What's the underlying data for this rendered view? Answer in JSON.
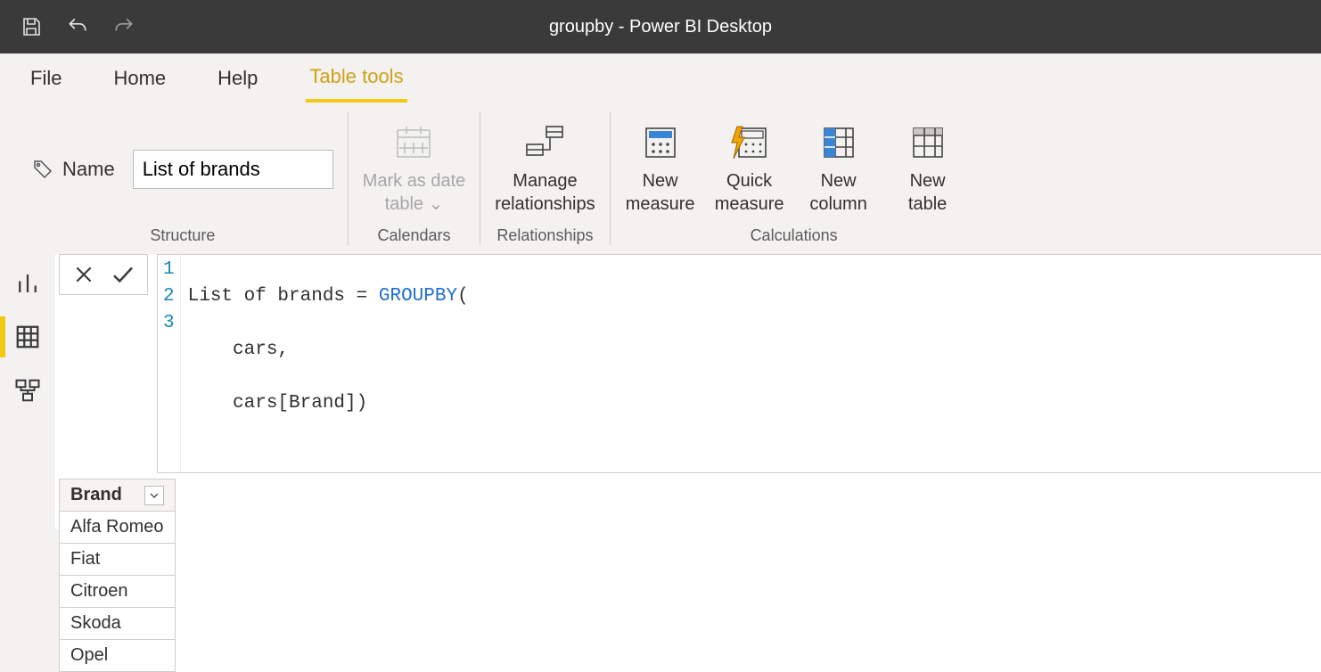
{
  "titlebar": {
    "title": "groupby - Power BI Desktop"
  },
  "ribbon_tabs": {
    "file": "File",
    "home": "Home",
    "help": "Help",
    "table_tools": "Table tools"
  },
  "structure": {
    "group_label": "Structure",
    "name_label": "Name",
    "name_value": "List of brands"
  },
  "calendars": {
    "group_label": "Calendars",
    "mark_date_line1": "Mark as date",
    "mark_date_line2": "table"
  },
  "relationships": {
    "group_label": "Relationships",
    "manage_line1": "Manage",
    "manage_line2": "relationships"
  },
  "calculations": {
    "group_label": "Calculations",
    "new_measure_line1": "New",
    "new_measure_line2": "measure",
    "quick_measure_line1": "Quick",
    "quick_measure_line2": "measure",
    "new_column_line1": "New",
    "new_column_line2": "column",
    "new_table_line1": "New",
    "new_table_line2": "table"
  },
  "formula": {
    "gutter": [
      "1",
      "2",
      "3"
    ],
    "line1_pre": "List of brands = ",
    "line1_func": "GROUPBY",
    "line1_post": "(",
    "line2": "    cars,",
    "line3": "    cars[Brand])"
  },
  "table": {
    "header": "Brand",
    "rows": [
      "Alfa Romeo",
      "Fiat",
      "Citroen",
      "Skoda",
      "Opel"
    ]
  }
}
